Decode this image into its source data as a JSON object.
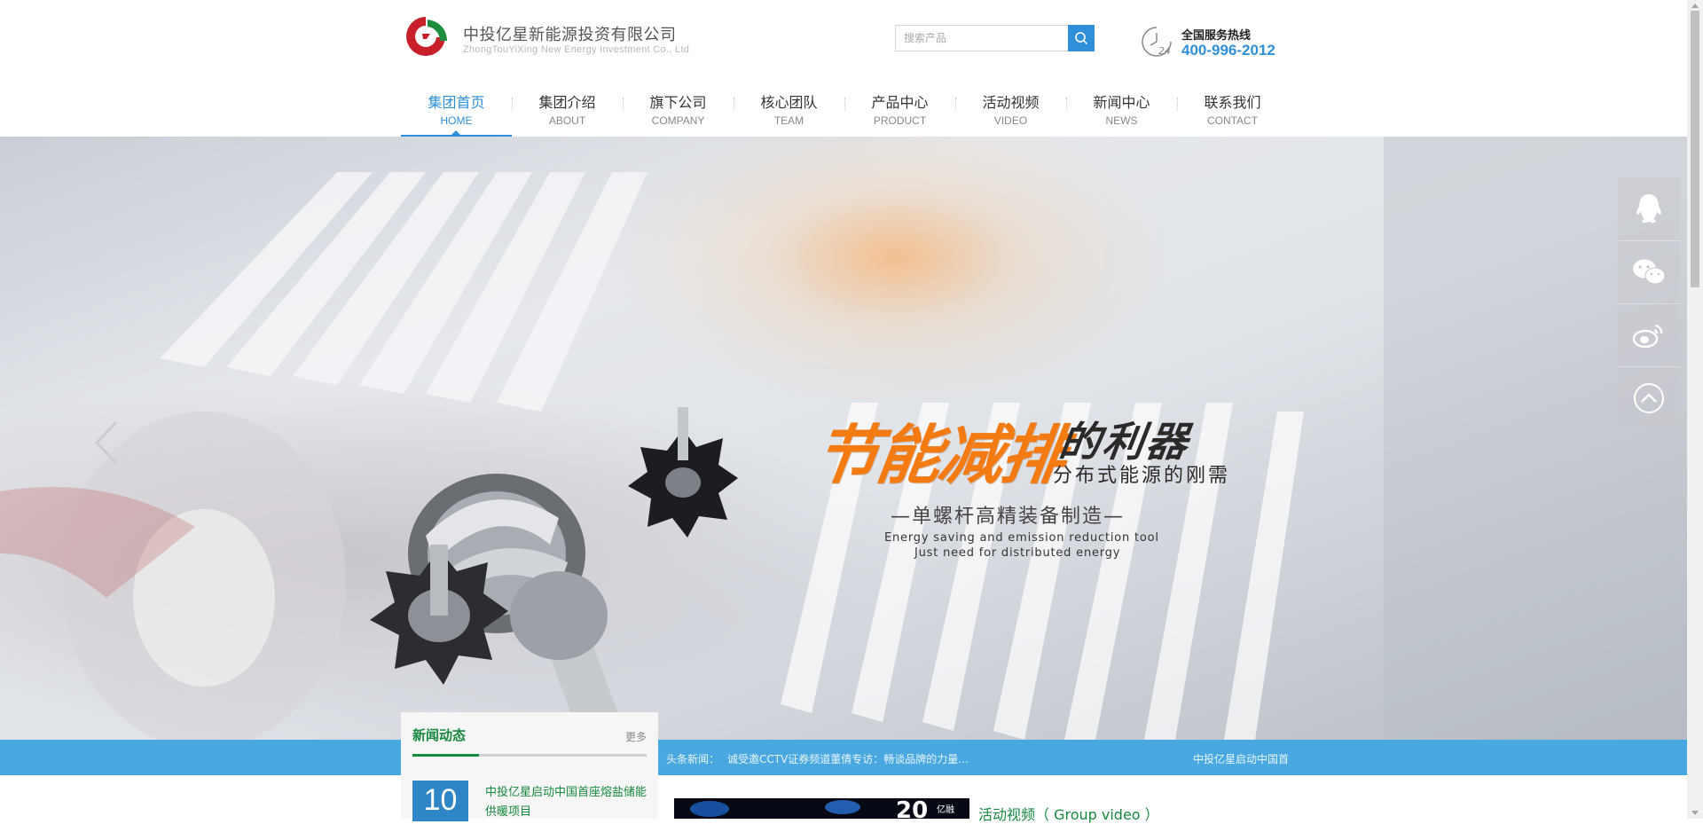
{
  "header": {
    "company_cn": "中投亿星新能源投资有限公司",
    "company_en": "ZhongTouYiXing New Energy Investment Co., Ltd",
    "search_placeholder": "搜索产品",
    "hotline_label": "全国服务热线",
    "hotline_number": "400-996-2012"
  },
  "nav": {
    "items": [
      {
        "cn": "集团首页",
        "en": "HOME",
        "active": true
      },
      {
        "cn": "集团介绍",
        "en": "ABOUT"
      },
      {
        "cn": "旗下公司",
        "en": "COMPANY"
      },
      {
        "cn": "核心团队",
        "en": "TEAM"
      },
      {
        "cn": "产品中心",
        "en": "PRODUCT"
      },
      {
        "cn": "活动视频",
        "en": "VIDEO"
      },
      {
        "cn": "新闻中心",
        "en": "NEWS"
      },
      {
        "cn": "联系我们",
        "en": "CONTACT"
      }
    ]
  },
  "banner": {
    "slogan_main": "节能减排",
    "slogan_dark": "的利器",
    "slogan_sub": "分布式能源的刚需",
    "slogan_line3": "—单螺杆高精装备制造—",
    "slogan_en1": "Energy saving and emission reduction tool",
    "slogan_en2": "Just need for distributed energy"
  },
  "ticker": {
    "label": "头条新闻：",
    "text": "诚受邀CCTV证券频道董倩专访：畅谈品牌的力量...",
    "text2": "中投亿星启动中国首"
  },
  "news": {
    "title": "新闻动态",
    "more": "更多",
    "date_day": "10",
    "item_title": "中投亿星启动中国首座熔盐储能供暖项目"
  },
  "video": {
    "title": "活动视频（ Group video ）"
  },
  "icons": [
    "logo-icon",
    "search-icon",
    "clock-24-icon",
    "arrow-left-icon",
    "arrow-right-icon",
    "qq-icon",
    "wechat-icon",
    "weibo-icon",
    "back-to-top-icon"
  ],
  "colors": {
    "accent_blue": "#2f8fd8",
    "green": "#16883f",
    "orange": "#f47a12",
    "ticker_bg": "#4aa8e0"
  }
}
